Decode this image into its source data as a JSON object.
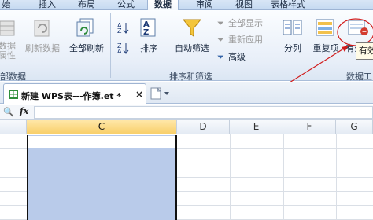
{
  "ribbon_tabs": [
    "始",
    "插入",
    "布局",
    "公式",
    "数据",
    "审阅",
    "视图",
    "表格样式"
  ],
  "ribbon": {
    "data_attr_label": "数据\n属性",
    "refresh_label": "刷新数据",
    "refresh_all_label": "全部刷新",
    "group_external_label": "部数据",
    "sort_label": "排序",
    "autofilter_label": "自动筛选",
    "show_all_label": "全部显示",
    "reapply_label": "重新应用",
    "advanced_label": "高级",
    "group_sort_filter_label": "排序和筛选",
    "split_label": "分列",
    "duplicates_label": "重复项",
    "validity_label": "有效性",
    "group_data_tools_label": "数据工",
    "tooltip_text": "有效"
  },
  "document": {
    "tab_title": "新建 WPS表---作簿.et *",
    "close_glyph": "×"
  },
  "formula_bar": {
    "fx_label": "fx"
  },
  "columns": [
    "C",
    "D",
    "E",
    "F",
    "G"
  ],
  "selected_column": "C",
  "colors": {
    "selection": "#b9cbea",
    "annotation_red": "#d11a1a",
    "active_tab": "#ffffff"
  }
}
